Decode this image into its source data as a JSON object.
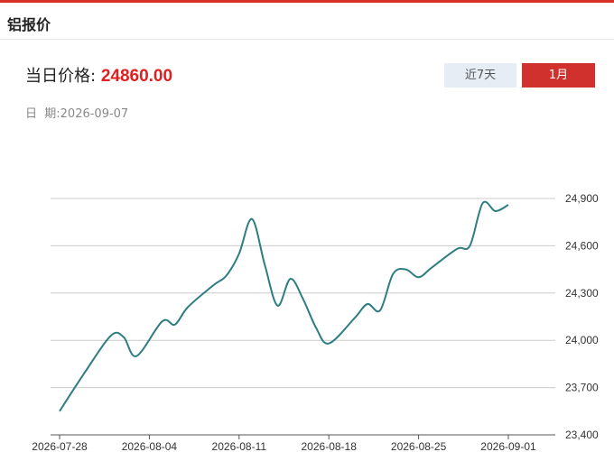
{
  "header": {
    "title": "铝报价"
  },
  "price": {
    "label": "当日价格:",
    "value": "24860.00"
  },
  "date": {
    "label": "日  期:",
    "value": "2026-09-07"
  },
  "range_buttons": {
    "week_label": "近7天",
    "month_label": "1月"
  },
  "colors": {
    "accent": "#d0312d",
    "line": "#2e7d82",
    "price": "#e02020"
  },
  "chart_data": {
    "type": "line",
    "title": "",
    "xlabel": "",
    "ylabel": "",
    "x": [
      "2026-07-28",
      "2026-07-29",
      "2026-07-30",
      "2026-07-31",
      "2026-08-01",
      "2026-08-02",
      "2026-08-03",
      "2026-08-04",
      "2026-08-05",
      "2026-08-06",
      "2026-08-07",
      "2026-08-08",
      "2026-08-09",
      "2026-08-10",
      "2026-08-11",
      "2026-08-12",
      "2026-08-13",
      "2026-08-14",
      "2026-08-15",
      "2026-08-16",
      "2026-08-17",
      "2026-08-18",
      "2026-08-19",
      "2026-08-20",
      "2026-08-21",
      "2026-08-22",
      "2026-08-23",
      "2026-08-24",
      "2026-08-25",
      "2026-08-26",
      "2026-08-27",
      "2026-08-28",
      "2026-08-29",
      "2026-08-30",
      "2026-08-31",
      "2026-09-01",
      "2026-09-02",
      "2026-09-03",
      "2026-09-04",
      "2026-09-05",
      "2026-09-06",
      "2026-09-07"
    ],
    "values": [
      23550,
      23800,
      24030,
      24020,
      23900,
      24120,
      24100,
      24210,
      24350,
      24410,
      24550,
      24770,
      24480,
      24220,
      24390,
      24260,
      24080,
      23980,
      24140,
      24230,
      24190,
      24420,
      24450,
      24400,
      24460,
      24580,
      24600,
      24870,
      24820,
      24860
    ],
    "value_dates": [
      "2026-07-28",
      "2026-07-30",
      "2026-08-01",
      "2026-08-02",
      "2026-08-03",
      "2026-08-05",
      "2026-08-06",
      "2026-08-07",
      "2026-08-09",
      "2026-08-10",
      "2026-08-11",
      "2026-08-12",
      "2026-08-13",
      "2026-08-14",
      "2026-08-15",
      "2026-08-16",
      "2026-08-17",
      "2026-08-18",
      "2026-08-20",
      "2026-08-21",
      "2026-08-22",
      "2026-08-23",
      "2026-08-24",
      "2026-08-25",
      "2026-08-26",
      "2026-08-28",
      "2026-08-29",
      "2026-08-30",
      "2026-08-31",
      "2026-09-01"
    ],
    "x_ticks": [
      "2026-07-28",
      "2026-08-04",
      "2026-08-11",
      "2026-08-18",
      "2026-08-25",
      "2026-09-01"
    ],
    "y_ticks": [
      "24,900",
      "24,600",
      "24,300",
      "24,000",
      "23,700",
      "23,400"
    ],
    "y_tick_values": [
      24900,
      24600,
      24300,
      24000,
      23700,
      23400
    ],
    "ylim": [
      23400,
      24900
    ],
    "grid": true,
    "y_axis_side": "right"
  }
}
